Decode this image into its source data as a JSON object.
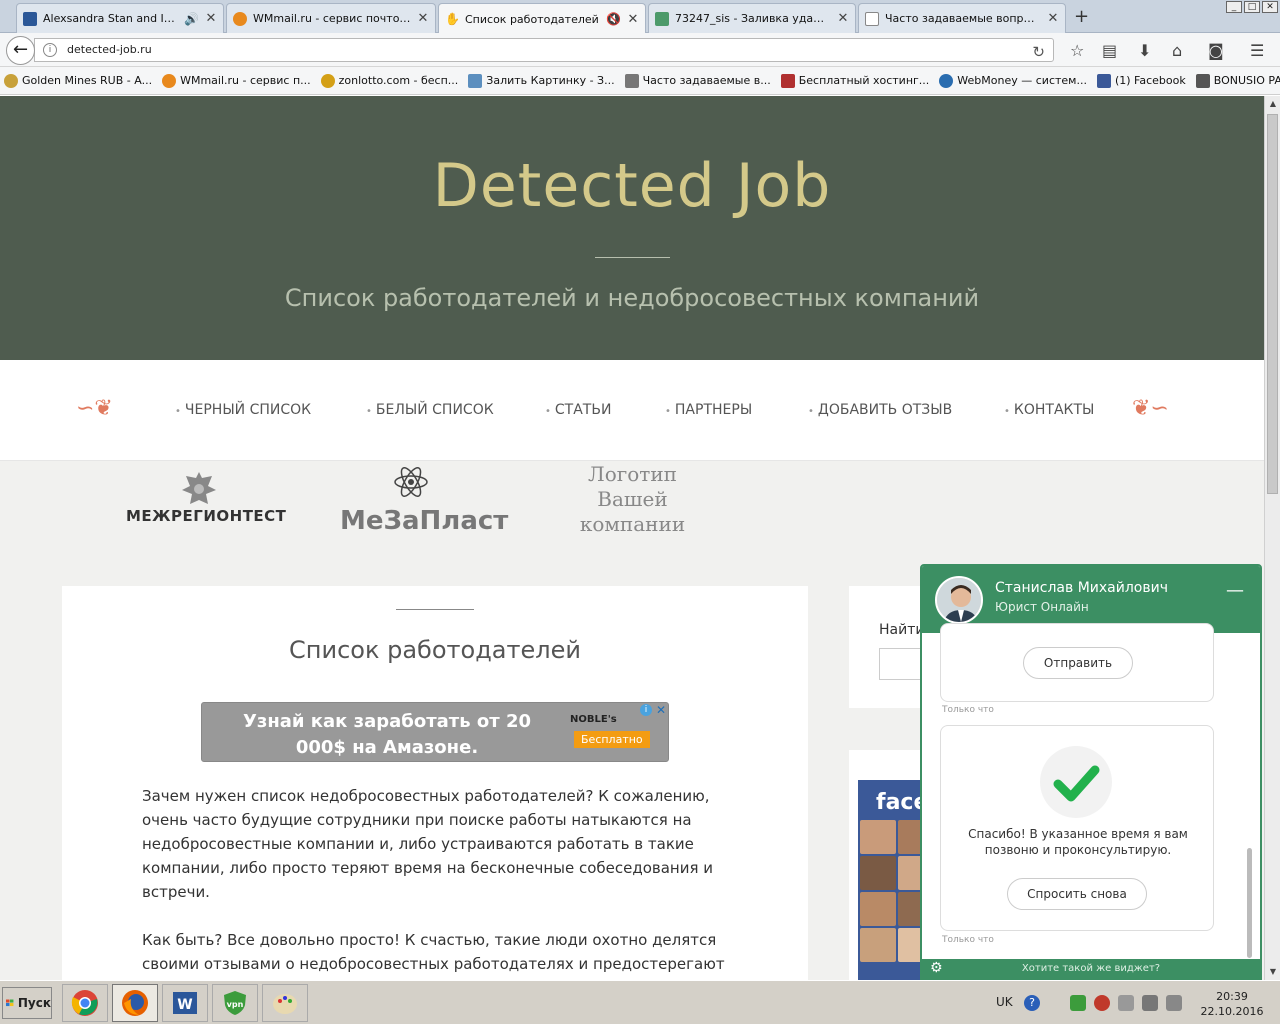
{
  "browser": {
    "tabs": [
      {
        "title": "Alexsandra Stan and Inn...",
        "favicon_color": "#2b5797",
        "audio": true
      },
      {
        "title": "WMmail.ru - сервис почтовы...",
        "favicon_color": "#e8891d",
        "audio": false
      },
      {
        "title": "Список работодателей",
        "favicon_color": "#333333",
        "audio": true,
        "active": true
      },
      {
        "title": "73247_sis - Заливка удалас...",
        "favicon_color": "#4c9a6a",
        "audio": false
      },
      {
        "title": "Часто задаваемые вопросы...",
        "favicon_color": "#888888",
        "audio": false
      }
    ],
    "new_tab": "+",
    "url": "detected-job.ru",
    "bookmarks": [
      {
        "label": "Golden Mines RUB - A...",
        "color": "#c8a13a"
      },
      {
        "label": "WMmail.ru - сервис п...",
        "color": "#e8891d"
      },
      {
        "label": "zonlotto.com - бесп...",
        "color": "#d4a017"
      },
      {
        "label": "Залить Картинку - З...",
        "color": "#5c8fbf"
      },
      {
        "label": "Часто задаваемые в...",
        "color": "#777777"
      },
      {
        "label": "Бесплатный хостинг...",
        "color": "#b03030"
      },
      {
        "label": "WebMoney — систем...",
        "color": "#2a6db0"
      },
      {
        "label": "(1) Facebook",
        "color": "#3b5998"
      },
      {
        "label": "BONUSIO PAYEER BO...",
        "color": "#555555"
      }
    ]
  },
  "site": {
    "brand": "Detected Job",
    "tagline": "Список работодателей и недобросовестных компаний",
    "menu": [
      "ЧЕРНЫЙ СПИСОК",
      "БЕЛЫЙ СПИСОК",
      "СТАТЬИ",
      "ПАРТНЕРЫ",
      "ДОБАВИТЬ ОТЗЫВ",
      "КОНТАКТЫ"
    ],
    "logos": {
      "logo1": "МЕЖРЕГИОНТЕСТ",
      "logo2": "МеЗаПласт",
      "logo3": "Логотип Вашей компании"
    },
    "page_title": "Список работодателей",
    "ad": {
      "text": "Узнай как заработать от 20 000$ на Амазоне.",
      "brand": "NOBLE's",
      "button": "Бесплатно"
    },
    "paragraph1": "Зачем нужен список недобросовестных работодателей? К сожалению, очень часто будущие сотрудники при поиске работы натыкаются на недобросовестные компании и, либо устраиваются работать в такие компании, либо просто теряют время на бесконечные собеседования и встречи.",
    "paragraph2": "Как быть? Все довольно просто! К счастью, такие люди охотно делятся своими отзывами о недобросовестных работодателях и предостерегают",
    "search_label": "Найти",
    "fb_label": "face"
  },
  "chat": {
    "name": "Станислав Михайлович",
    "role": "Юрист Онлайн",
    "send_button": "Отправить",
    "timestamp1": "Только что",
    "thanks": "Спасибо! В указанное время я вам позвоню и проконсультирую.",
    "ask_again": "Спросить снова",
    "timestamp2": "Только что",
    "footer": "Хотите такой же виджет?",
    "accent": "#3c8f63"
  },
  "taskbar": {
    "start": "Пуск",
    "lang": "UK",
    "time": "20:39",
    "date": "22.10.2016"
  }
}
